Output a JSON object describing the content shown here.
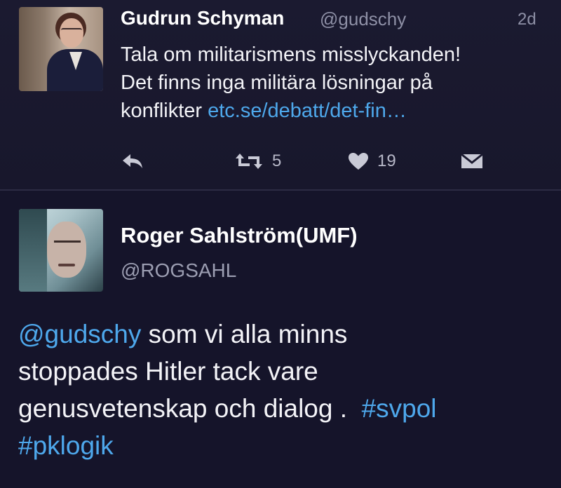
{
  "tweet1": {
    "author_name": "Gudrun Schyman",
    "author_handle": "@gudschy",
    "time": "2d",
    "text_line1": "Tala om militarismens misslyckanden!",
    "text_line2": "Det finns inga militära lösningar på",
    "text_line3_prefix": "konflikter",
    "link": "etc.se/debatt/det-fin…",
    "retweet_count": "5",
    "like_count": "19",
    "icons": [
      "reply-icon",
      "retweet-icon",
      "heart-icon",
      "dm-icon"
    ]
  },
  "tweet2": {
    "author_name": "Roger Sahlström(UMF)",
    "author_handle": "@ROGSAHL",
    "mention": "@gudschy",
    "text_line1": "som vi alla minns",
    "text_line2": "stoppades Hitler tack vare",
    "text_line3": "genusvetenskap och dialog .",
    "hashtag1": "#svpol",
    "hashtag2": "#pklogik"
  },
  "colors": {
    "background": "#15142a",
    "link": "#4ea8ec",
    "muted": "#8e90a6",
    "text": "#f3f3f7"
  }
}
